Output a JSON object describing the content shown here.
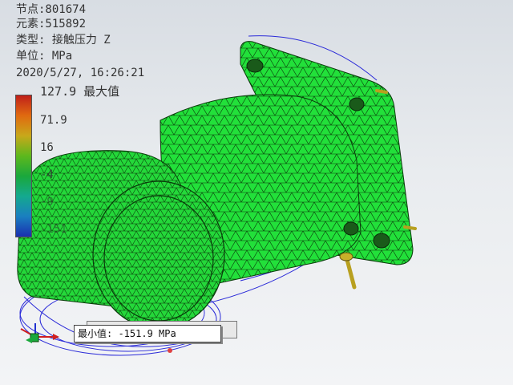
{
  "info": {
    "nodes": "节点:801674",
    "elements": "元素:515892",
    "type": "类型: 接触压力 Z",
    "unit": "单位: MPa",
    "timestamp": "2020/5/27, 16:26:21"
  },
  "legend": {
    "max_label": "127.9 最大值",
    "tick1": "71.9",
    "tick2": "16",
    "tick3": "-4",
    "tick4": "-9",
    "tick5": "-151",
    "colors": [
      "#c0201a",
      "#e06a10",
      "#c8a81a",
      "#5db81d",
      "#1aa83c",
      "#14a98f",
      "#1a7fc0",
      "#1a2fb0"
    ]
  },
  "tooltip": {
    "min_text": "最小值: -151.9 MPa"
  },
  "icons": {
    "axis_triad": "xyz-axis-icon"
  },
  "colors": {
    "mesh_fill": "#22e03a",
    "mesh_lines": "#0a3a0a",
    "wire_outline": "#2a2ad8",
    "bolt": "#b8a020"
  }
}
